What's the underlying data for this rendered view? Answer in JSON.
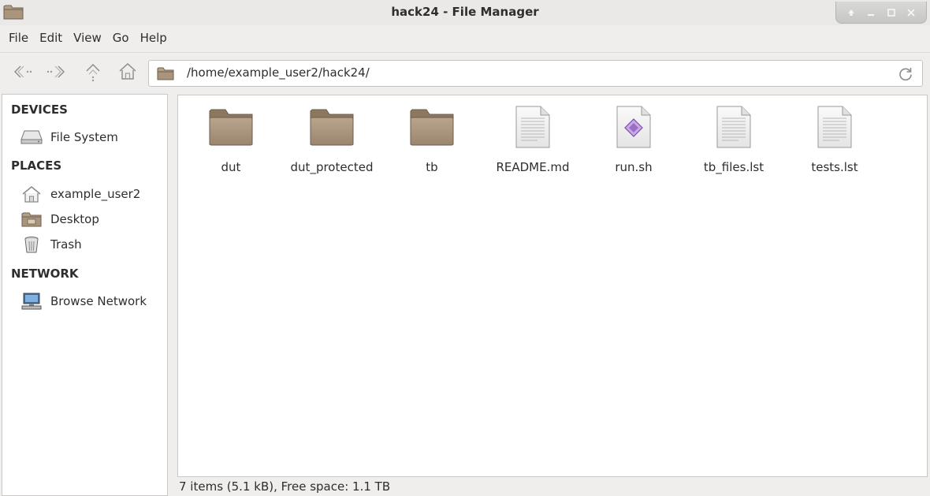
{
  "window": {
    "title": "hack24 - File Manager",
    "app_icon": "folder-icon",
    "controls": [
      "up-arrow-icon",
      "minimize-icon",
      "maximize-icon",
      "close-icon"
    ]
  },
  "menubar": {
    "items": [
      "File",
      "Edit",
      "View",
      "Go",
      "Help"
    ]
  },
  "toolbar": {
    "buttons": [
      "back-icon",
      "forward-icon",
      "parent-icon",
      "home-icon"
    ],
    "location": "/home/example_user2/hack24/"
  },
  "sidebar": {
    "sections": [
      {
        "title": "DEVICES",
        "items": [
          {
            "label": "File System",
            "icon": "drive-icon"
          }
        ]
      },
      {
        "title": "PLACES",
        "items": [
          {
            "label": "example_user2",
            "icon": "home-icon"
          },
          {
            "label": "Desktop",
            "icon": "desktop-folder-icon"
          },
          {
            "label": "Trash",
            "icon": "trash-icon"
          }
        ]
      },
      {
        "title": "NETWORK",
        "items": [
          {
            "label": "Browse Network",
            "icon": "network-icon"
          }
        ]
      }
    ]
  },
  "files": [
    {
      "name": "dut",
      "kind": "folder"
    },
    {
      "name": "dut_protected",
      "kind": "folder"
    },
    {
      "name": "tb",
      "kind": "folder"
    },
    {
      "name": "README.md",
      "kind": "text"
    },
    {
      "name": "run.sh",
      "kind": "script"
    },
    {
      "name": "tb_files.lst",
      "kind": "text"
    },
    {
      "name": "tests.lst",
      "kind": "text"
    }
  ],
  "status": "7 items (5.1 kB), Free space: 1.1 TB",
  "colors": {
    "window_bg": "#efeeec",
    "folder": "#a8937a",
    "folder_dark": "#8c7860",
    "accent": "#9b6fc4"
  }
}
